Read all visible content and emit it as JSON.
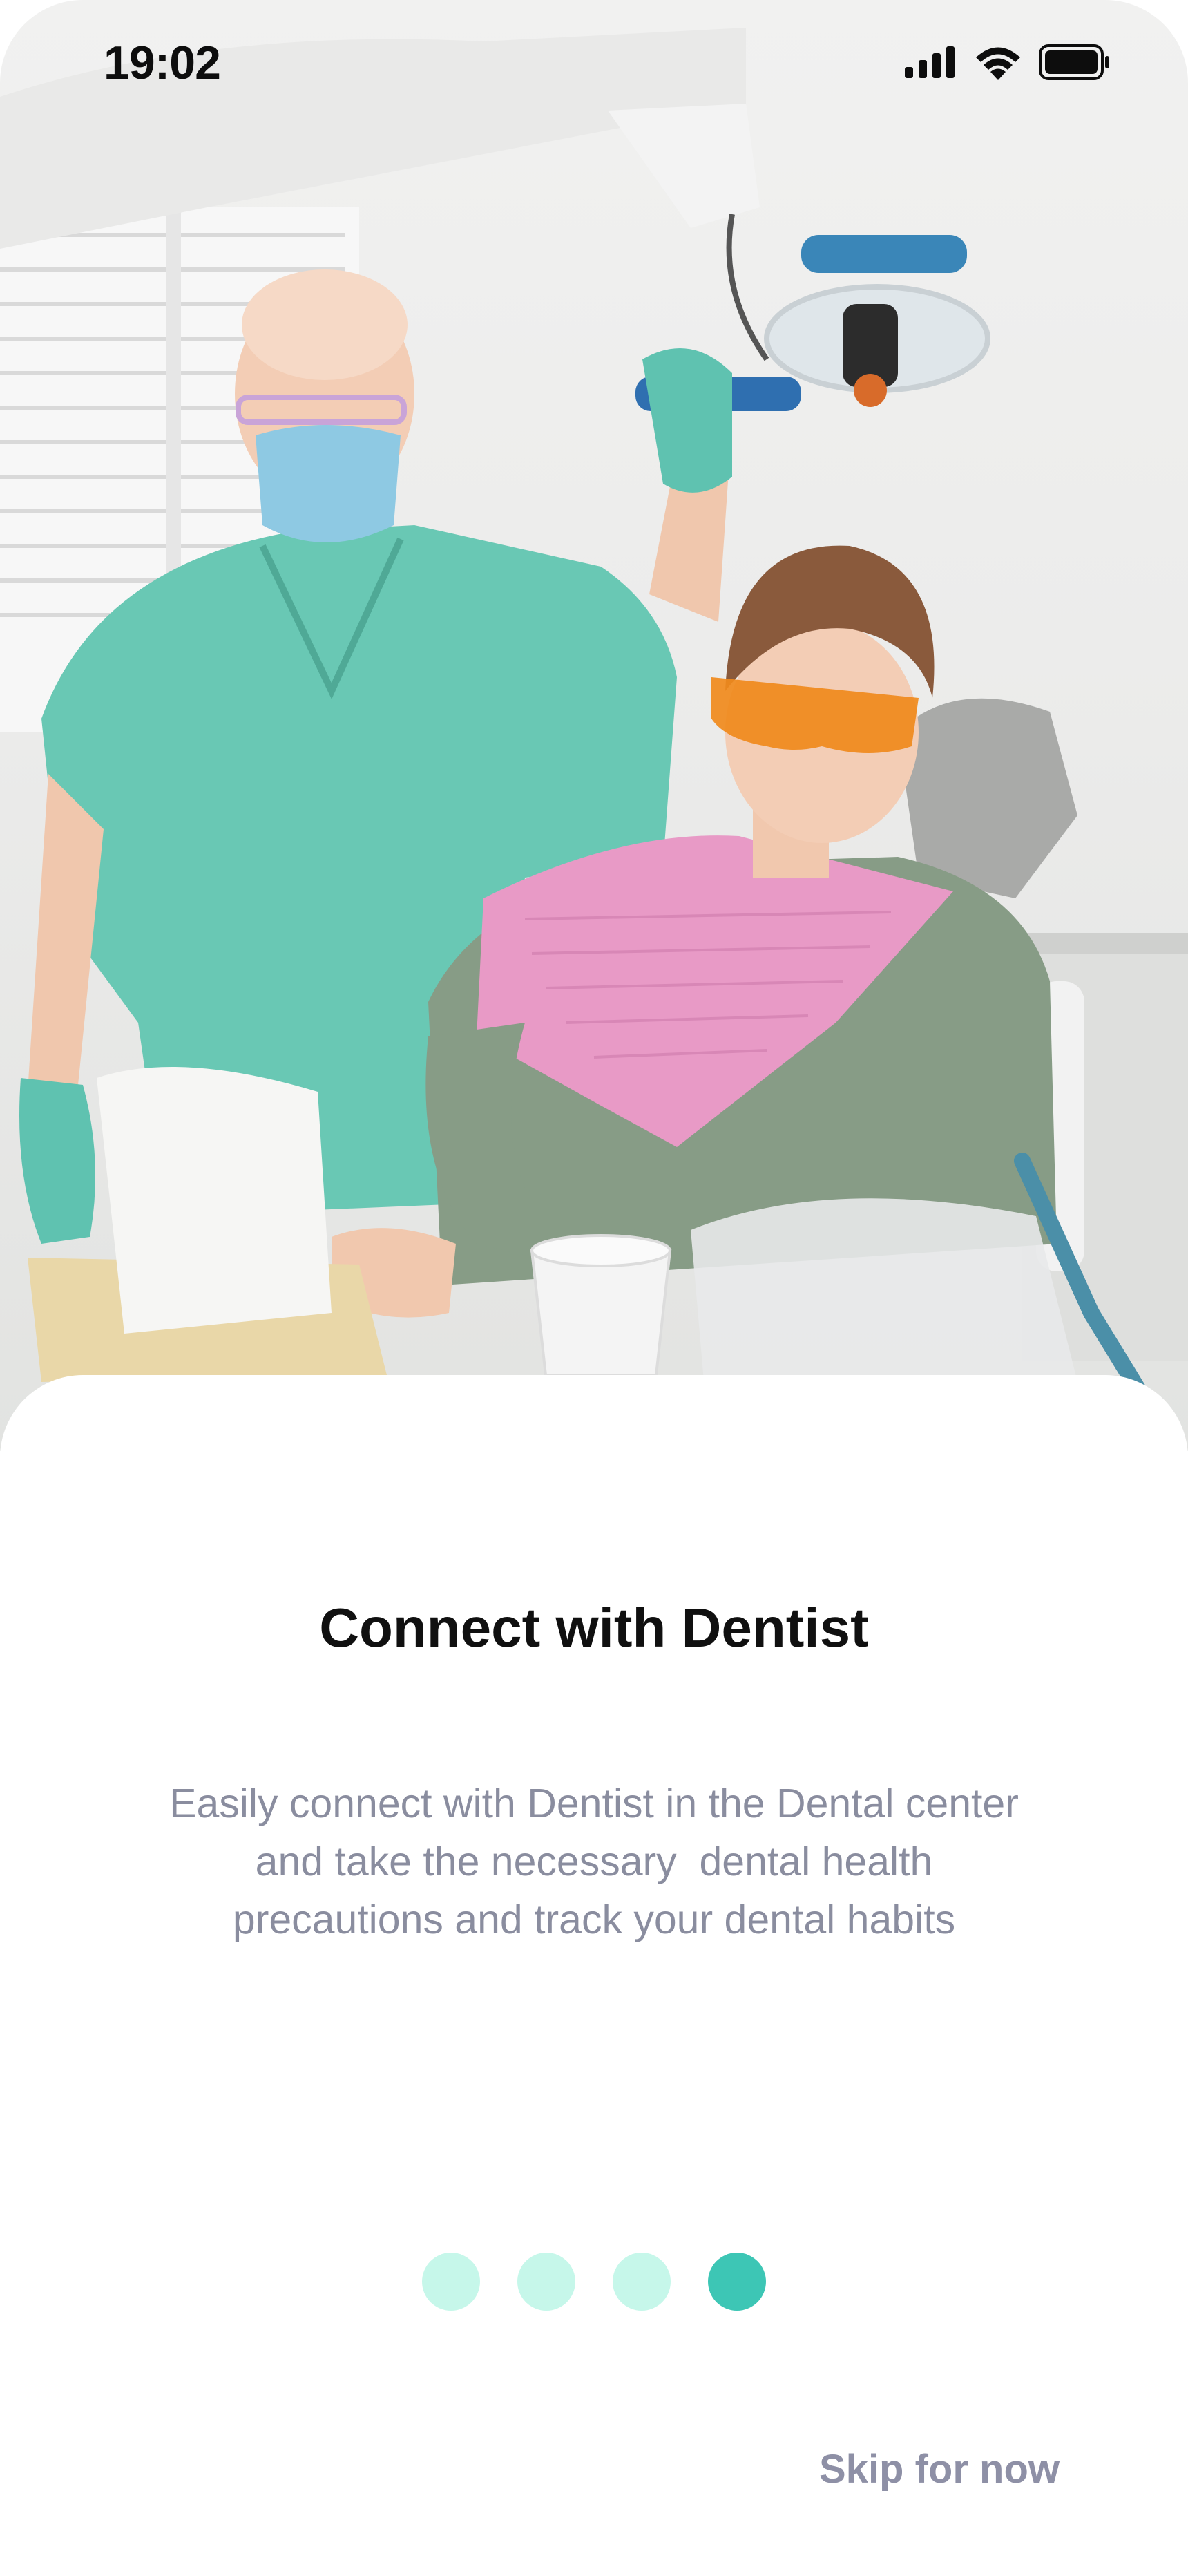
{
  "status_bar": {
    "time": "19:02",
    "icons": [
      "cellular-signal-icon",
      "wifi-icon",
      "battery-icon"
    ]
  },
  "hero": {
    "image_name": "dental-clinic-photo"
  },
  "onboarding": {
    "title": "Connect with Dentist",
    "description_lines": [
      "Easily connect with Dentist in the Dental center",
      "and take the necessary  dental health",
      "precautions and track your dental habits"
    ],
    "pager": {
      "total": 4,
      "active_index": 3
    },
    "skip_label": "Skip for now"
  },
  "colors": {
    "accent": "#3dc6b5",
    "dot_inactive": "#c6f7ea",
    "description_text": "#8a8d9f",
    "skip_text": "#8e90a6",
    "title_text": "#101010"
  }
}
